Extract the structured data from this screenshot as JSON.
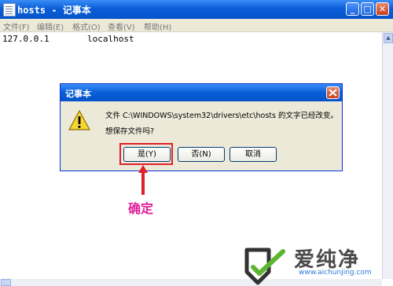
{
  "window": {
    "title": "hosts - 记事本",
    "controls": [
      "minimize",
      "maximize",
      "close"
    ]
  },
  "menu": [
    "文件(F)",
    "编辑(E)",
    "格式(O)",
    "查看(V)",
    "帮助(H)"
  ],
  "editor": {
    "ip": "127.0.0.1",
    "host": "localhost"
  },
  "dialog": {
    "title": "记事本",
    "message_line1": "文件 C:\\WINDOWS\\system32\\drivers\\etc\\hosts 的文字已经改变。",
    "message_line2": "想保存文件吗?",
    "buttons": {
      "yes": "是(Y)",
      "no": "否(N)",
      "cancel": "取消"
    }
  },
  "annotation": {
    "label": "确定",
    "color": "#e0202a"
  },
  "watermark": {
    "brand": "爱纯净",
    "url": "www.aichunjing.com"
  }
}
